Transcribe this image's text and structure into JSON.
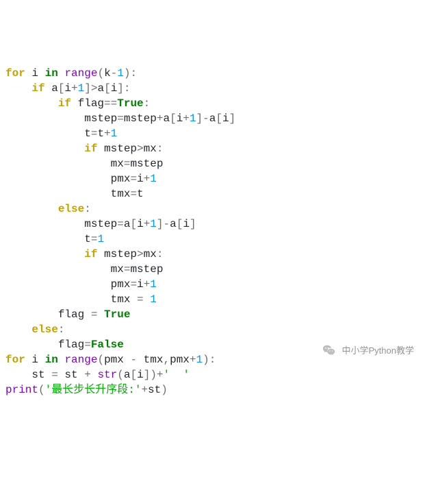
{
  "code_tokens": [
    [
      [
        "kw",
        "for"
      ],
      [
        "pl",
        " i "
      ],
      [
        "kw2",
        "in"
      ],
      [
        "pl",
        " "
      ],
      [
        "fn",
        "range"
      ],
      [
        "op",
        "("
      ],
      [
        "pl",
        "k"
      ],
      [
        "op",
        "-"
      ],
      [
        "num",
        "1"
      ],
      [
        "op",
        ")"
      ],
      [
        "op",
        ":"
      ]
    ],
    [
      [
        "pl",
        "    "
      ],
      [
        "kw",
        "if"
      ],
      [
        "pl",
        " a"
      ],
      [
        "op",
        "["
      ],
      [
        "pl",
        "i"
      ],
      [
        "op",
        "+"
      ],
      [
        "num",
        "1"
      ],
      [
        "op",
        "]"
      ],
      [
        "op",
        ">"
      ],
      [
        "pl",
        "a"
      ],
      [
        "op",
        "["
      ],
      [
        "pl",
        "i"
      ],
      [
        "op",
        "]"
      ],
      [
        "op",
        ":"
      ]
    ],
    [
      [
        "pl",
        "        "
      ],
      [
        "kw",
        "if"
      ],
      [
        "pl",
        " flag"
      ],
      [
        "op",
        "=="
      ],
      [
        "val",
        "True"
      ],
      [
        "op",
        ":"
      ]
    ],
    [
      [
        "pl",
        "            mstep"
      ],
      [
        "op",
        "="
      ],
      [
        "pl",
        "mstep"
      ],
      [
        "op",
        "+"
      ],
      [
        "pl",
        "a"
      ],
      [
        "op",
        "["
      ],
      [
        "pl",
        "i"
      ],
      [
        "op",
        "+"
      ],
      [
        "num",
        "1"
      ],
      [
        "op",
        "]"
      ],
      [
        "op",
        "-"
      ],
      [
        "pl",
        "a"
      ],
      [
        "op",
        "["
      ],
      [
        "pl",
        "i"
      ],
      [
        "op",
        "]"
      ]
    ],
    [
      [
        "pl",
        "            t"
      ],
      [
        "op",
        "="
      ],
      [
        "pl",
        "t"
      ],
      [
        "op",
        "+"
      ],
      [
        "num",
        "1"
      ]
    ],
    [
      [
        "pl",
        "            "
      ],
      [
        "kw",
        "if"
      ],
      [
        "pl",
        " mstep"
      ],
      [
        "op",
        ">"
      ],
      [
        "pl",
        "mx"
      ],
      [
        "op",
        ":"
      ]
    ],
    [
      [
        "pl",
        "                mx"
      ],
      [
        "op",
        "="
      ],
      [
        "pl",
        "mstep"
      ]
    ],
    [
      [
        "pl",
        "                pmx"
      ],
      [
        "op",
        "="
      ],
      [
        "pl",
        "i"
      ],
      [
        "op",
        "+"
      ],
      [
        "num",
        "1"
      ]
    ],
    [
      [
        "pl",
        "                tmx"
      ],
      [
        "op",
        "="
      ],
      [
        "pl",
        "t"
      ]
    ],
    [
      [
        "pl",
        "        "
      ],
      [
        "kw",
        "else"
      ],
      [
        "op",
        ":"
      ]
    ],
    [
      [
        "pl",
        "            mstep"
      ],
      [
        "op",
        "="
      ],
      [
        "pl",
        "a"
      ],
      [
        "op",
        "["
      ],
      [
        "pl",
        "i"
      ],
      [
        "op",
        "+"
      ],
      [
        "num",
        "1"
      ],
      [
        "op",
        "]"
      ],
      [
        "op",
        "-"
      ],
      [
        "pl",
        "a"
      ],
      [
        "op",
        "["
      ],
      [
        "pl",
        "i"
      ],
      [
        "op",
        "]"
      ]
    ],
    [
      [
        "pl",
        "            t"
      ],
      [
        "op",
        "="
      ],
      [
        "num",
        "1"
      ]
    ],
    [
      [
        "pl",
        "            "
      ],
      [
        "kw",
        "if"
      ],
      [
        "pl",
        " mstep"
      ],
      [
        "op",
        ">"
      ],
      [
        "pl",
        "mx"
      ],
      [
        "op",
        ":"
      ]
    ],
    [
      [
        "pl",
        "                mx"
      ],
      [
        "op",
        "="
      ],
      [
        "pl",
        "mstep"
      ]
    ],
    [
      [
        "pl",
        "                pmx"
      ],
      [
        "op",
        "="
      ],
      [
        "pl",
        "i"
      ],
      [
        "op",
        "+"
      ],
      [
        "num",
        "1"
      ]
    ],
    [
      [
        "pl",
        "                tmx "
      ],
      [
        "op",
        "="
      ],
      [
        "pl",
        " "
      ],
      [
        "num",
        "1"
      ]
    ],
    [
      [
        "pl",
        "        flag "
      ],
      [
        "op",
        "="
      ],
      [
        "pl",
        " "
      ],
      [
        "val",
        "True"
      ]
    ],
    [
      [
        "pl",
        "    "
      ],
      [
        "kw",
        "else"
      ],
      [
        "op",
        ":"
      ]
    ],
    [
      [
        "pl",
        "        flag"
      ],
      [
        "op",
        "="
      ],
      [
        "val",
        "False"
      ]
    ],
    [
      [
        "kw",
        "for"
      ],
      [
        "pl",
        " i "
      ],
      [
        "kw2",
        "in"
      ],
      [
        "pl",
        " "
      ],
      [
        "fn",
        "range"
      ],
      [
        "op",
        "("
      ],
      [
        "pl",
        "pmx "
      ],
      [
        "op",
        "-"
      ],
      [
        "pl",
        " tmx"
      ],
      [
        "op",
        ","
      ],
      [
        "pl",
        "pmx"
      ],
      [
        "op",
        "+"
      ],
      [
        "num",
        "1"
      ],
      [
        "op",
        ")"
      ],
      [
        "op",
        ":"
      ]
    ],
    [
      [
        "pl",
        "    st "
      ],
      [
        "op",
        "="
      ],
      [
        "pl",
        " st "
      ],
      [
        "op",
        "+"
      ],
      [
        "pl",
        " "
      ],
      [
        "fn",
        "str"
      ],
      [
        "op",
        "("
      ],
      [
        "pl",
        "a"
      ],
      [
        "op",
        "["
      ],
      [
        "pl",
        "i"
      ],
      [
        "op",
        "]"
      ],
      [
        "op",
        ")"
      ],
      [
        "op",
        "+"
      ],
      [
        "str",
        "'  '"
      ]
    ],
    [
      [
        "fn",
        "print"
      ],
      [
        "op",
        "("
      ],
      [
        "str",
        "'最长步长升序段:'"
      ],
      [
        "op",
        "+"
      ],
      [
        "pl",
        "st"
      ],
      [
        "op",
        ")"
      ]
    ]
  ],
  "footer": {
    "text": "中小学Python教学"
  }
}
